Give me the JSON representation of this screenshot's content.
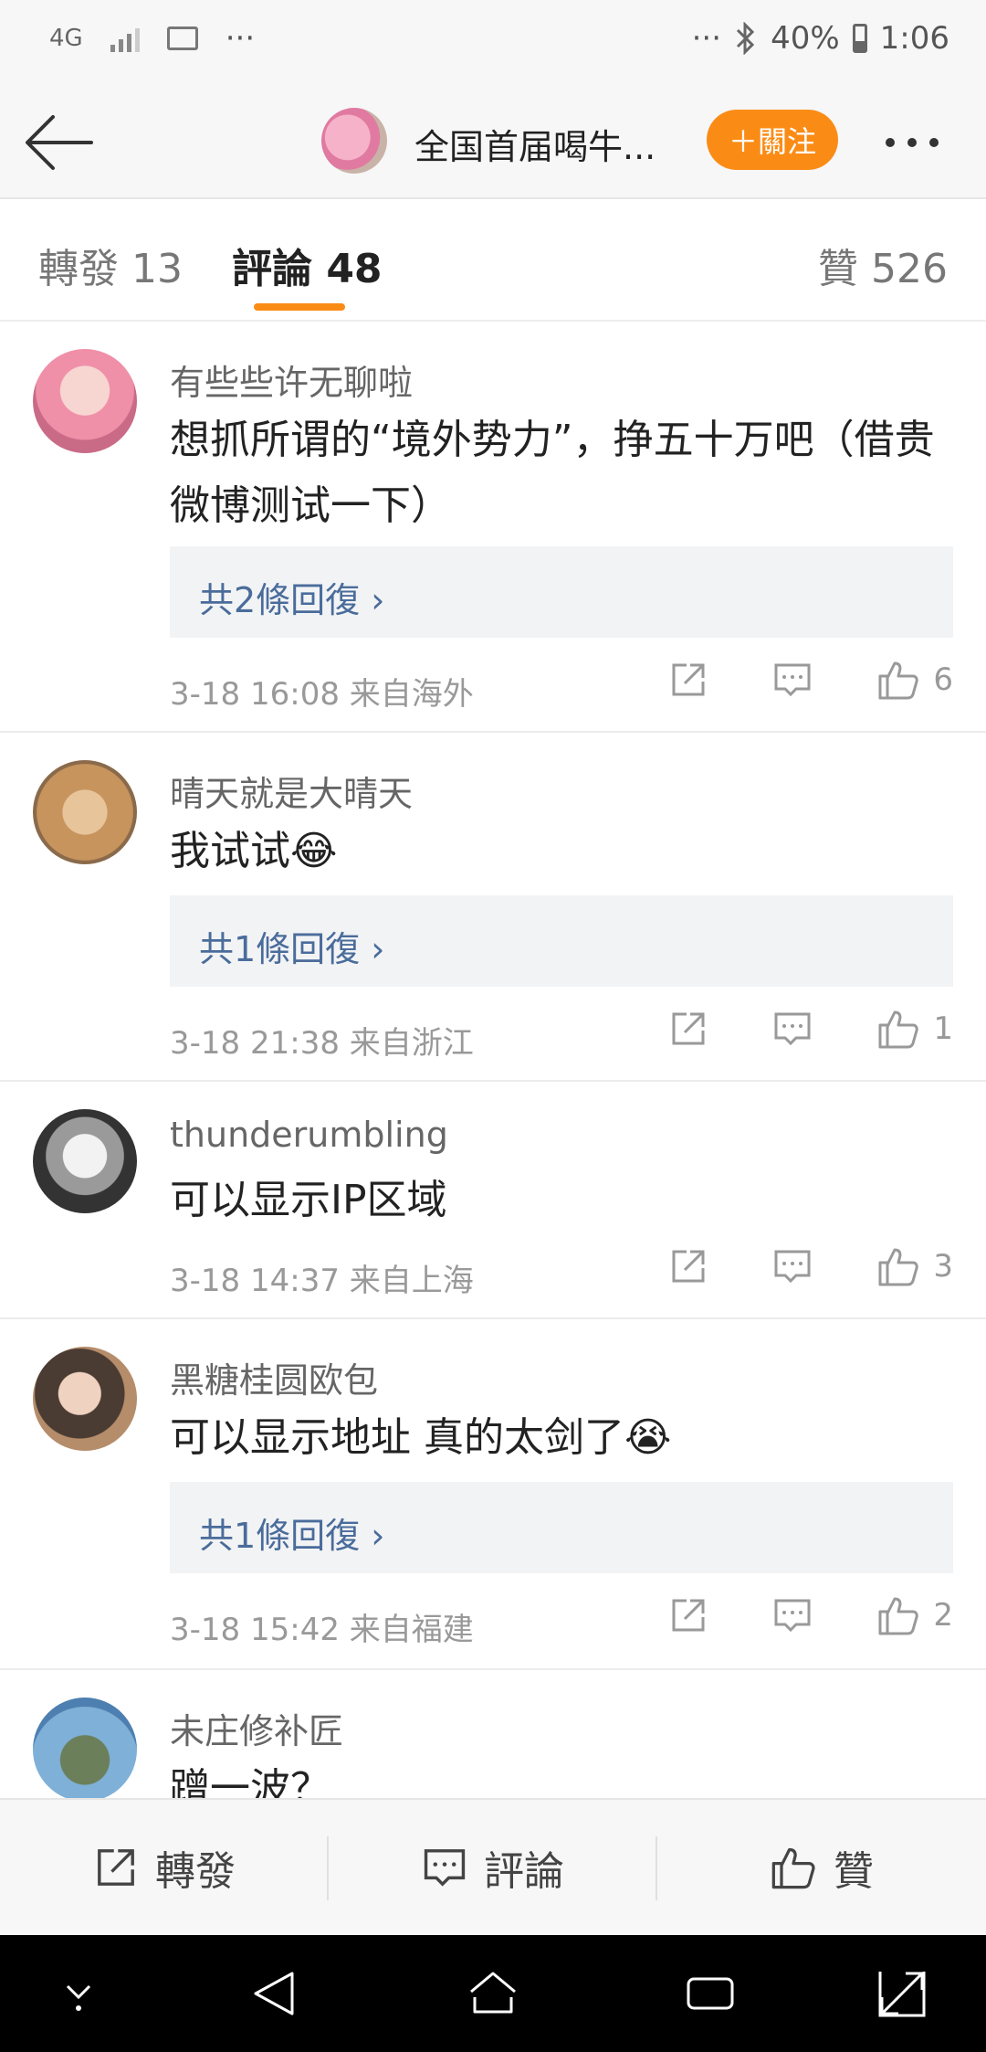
{
  "status_bar": {
    "network": "4G",
    "more_left": "···",
    "more_right": "···",
    "battery": "40%",
    "time": "1:06"
  },
  "header": {
    "title": "全国首届喝牛...",
    "follow_label": "＋關注"
  },
  "tabs": [
    {
      "label": "轉發 13"
    },
    {
      "label": "評論 48"
    },
    {
      "label": "贊 526"
    }
  ],
  "colors": {
    "accent": "#fa8c16",
    "link": "#4a6c9b"
  },
  "comments": [
    {
      "user": "有些些许无聊啦",
      "text": "想抓所谓的“境外势力”，挣五十万吧（借贵微博测试一下）",
      "replies": "共2條回復 ›",
      "meta": "3-18 16:08  来自海外",
      "likes": "6"
    },
    {
      "user": "晴天就是大晴天",
      "text": "我试试😂",
      "replies": "共1條回復 ›",
      "meta": "3-18 21:38  来自浙江",
      "likes": "1"
    },
    {
      "user": "thunderumbling",
      "text": "可以显示IP区域",
      "meta": "3-18 14:37  来自上海",
      "likes": "3"
    },
    {
      "user": "黑糖桂圆欧包",
      "text": "可以显示地址 真的太剑了😭",
      "replies": "共1條回復 ›",
      "meta": "3-18 15:42  来自福建",
      "likes": "2"
    },
    {
      "user": "未庄修补匠",
      "text": "蹭一波？"
    }
  ],
  "bottom_bar": {
    "repost": "轉發",
    "comment": "評論",
    "like": "贊"
  }
}
